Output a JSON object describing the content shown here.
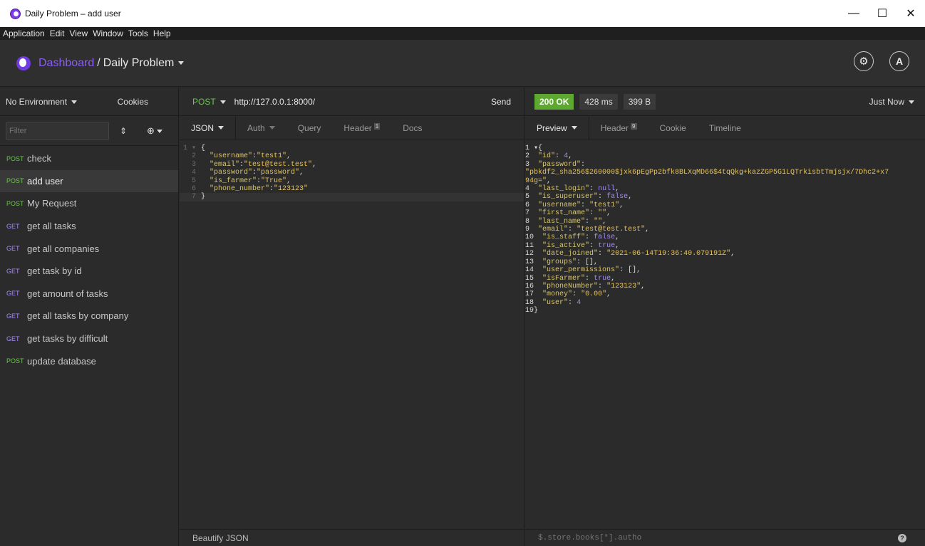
{
  "window": {
    "title": "Daily Problem – add user",
    "minimize": "—",
    "maximize": "☐",
    "close": "✕"
  },
  "menu": [
    "Application",
    "Edit",
    "View",
    "Window",
    "Tools",
    "Help"
  ],
  "header": {
    "dashboard": "Dashboard",
    "separator": "/",
    "workspace": "Daily Problem"
  },
  "sidebar": {
    "environment": "No Environment",
    "cookies": "Cookies",
    "filter_placeholder": "Filter",
    "requests": [
      {
        "method": "POST",
        "name": "check"
      },
      {
        "method": "POST",
        "name": "add user"
      },
      {
        "method": "POST",
        "name": "My Request"
      },
      {
        "method": "GET",
        "name": "get all tasks"
      },
      {
        "method": "GET",
        "name": "get all companies"
      },
      {
        "method": "GET",
        "name": "get task by id"
      },
      {
        "method": "GET",
        "name": "get amount of tasks"
      },
      {
        "method": "GET",
        "name": "get all tasks by company"
      },
      {
        "method": "GET",
        "name": "get tasks by difficult"
      },
      {
        "method": "POST",
        "name": "update database"
      }
    ]
  },
  "request": {
    "method": "POST",
    "url": "http://127.0.0.1:8000/",
    "send": "Send",
    "tabs": {
      "body": "JSON",
      "auth": "Auth",
      "query": "Query",
      "header": "Header",
      "header_count": "1",
      "docs": "Docs"
    },
    "beautify": "Beautify JSON"
  },
  "response": {
    "status": "200 OK",
    "time": "428 ms",
    "size": "399 B",
    "when": "Just Now",
    "tabs": {
      "preview": "Preview",
      "header": "Header",
      "header_count": "9",
      "cookie": "Cookie",
      "timeline": "Timeline"
    },
    "filter_placeholder": "$.store.books[*].author"
  }
}
